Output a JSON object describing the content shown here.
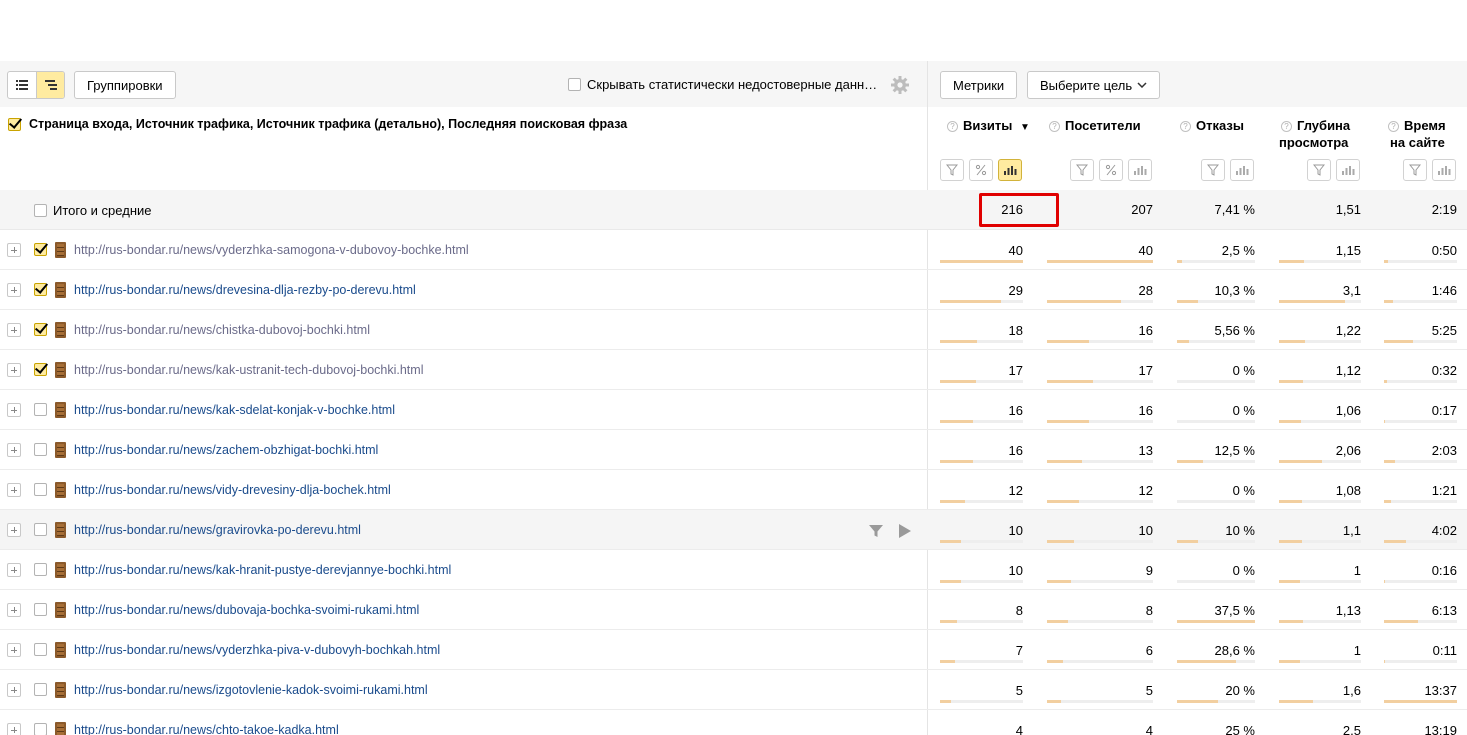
{
  "toolbar": {
    "groupings_label": "Группировки",
    "hide_stat_label": "Скрывать статистически недостоверные данн…",
    "metrics_label": "Метрики",
    "goal_label": "Выберите цель"
  },
  "table": {
    "dimension_header": "Страница входа, Источник трафика, Источник трафика (детально), Последняя поисковая фраза",
    "columns": [
      {
        "label": "Визиты",
        "sort": "▼"
      },
      {
        "label": "Посетители"
      },
      {
        "label": "Отказы"
      },
      {
        "label": "Глубина просмотра",
        "line1": "Глубина",
        "line2": "просмотра"
      },
      {
        "label": "Время на сайте",
        "line1": "Время",
        "line2": "на сайте"
      }
    ],
    "totals": {
      "label": "Итого и средние",
      "visits": "216",
      "visitors": "207",
      "bounces": "7,41 %",
      "depth": "1,51",
      "time": "2:19"
    },
    "rows": [
      {
        "url": "http://rus-bondar.ru/news/vyderzhka-samogona-v-dubovoy-bochke.html",
        "checked": true,
        "visited": true,
        "visits": "40",
        "visitors": "40",
        "bounces": "2,5 %",
        "depth": "1,15",
        "time": "0:50",
        "fill": [
          1.0,
          1.0,
          0.07,
          0.3,
          0.05
        ]
      },
      {
        "url": "http://rus-bondar.ru/news/drevesina-dlja-rezby-po-derevu.html",
        "checked": true,
        "visited": false,
        "visits": "29",
        "visitors": "28",
        "bounces": "10,3 %",
        "depth": "3,1",
        "time": "1:46",
        "fill": [
          0.73,
          0.7,
          0.27,
          0.8,
          0.13
        ]
      },
      {
        "url": "http://rus-bondar.ru/news/chistka-dubovoj-bochki.html",
        "checked": true,
        "visited": true,
        "visits": "18",
        "visitors": "16",
        "bounces": "5,56 %",
        "depth": "1,22",
        "time": "5:25",
        "fill": [
          0.45,
          0.4,
          0.15,
          0.32,
          0.4
        ]
      },
      {
        "url": "http://rus-bondar.ru/news/kak-ustranit-tech-dubovoj-bochki.html",
        "checked": true,
        "visited": true,
        "visits": "17",
        "visitors": "17",
        "bounces": "0 %",
        "depth": "1,12",
        "time": "0:32",
        "fill": [
          0.43,
          0.43,
          0.0,
          0.29,
          0.04
        ]
      },
      {
        "url": "http://rus-bondar.ru/news/kak-sdelat-konjak-v-bochke.html",
        "checked": false,
        "visited": false,
        "visits": "16",
        "visitors": "16",
        "bounces": "0 %",
        "depth": "1,06",
        "time": "0:17",
        "fill": [
          0.4,
          0.4,
          0.0,
          0.27,
          0.02
        ]
      },
      {
        "url": "http://rus-bondar.ru/news/zachem-obzhigat-bochki.html",
        "checked": false,
        "visited": false,
        "visits": "16",
        "visitors": "13",
        "bounces": "12,5 %",
        "depth": "2,06",
        "time": "2:03",
        "fill": [
          0.4,
          0.33,
          0.33,
          0.53,
          0.15
        ]
      },
      {
        "url": "http://rus-bondar.ru/news/vidy-drevesiny-dlja-bochek.html",
        "checked": false,
        "visited": false,
        "visits": "12",
        "visitors": "12",
        "bounces": "0 %",
        "depth": "1,08",
        "time": "1:21",
        "fill": [
          0.3,
          0.3,
          0.0,
          0.28,
          0.1
        ]
      },
      {
        "url": "http://rus-bondar.ru/news/gravirovka-po-derevu.html",
        "checked": false,
        "visited": false,
        "hover": true,
        "visits": "10",
        "visitors": "10",
        "bounces": "10 %",
        "depth": "1,1",
        "time": "4:02",
        "fill": [
          0.25,
          0.25,
          0.27,
          0.28,
          0.3
        ]
      },
      {
        "url": "http://rus-bondar.ru/news/kak-hranit-pustye-derevjannye-bochki.html",
        "checked": false,
        "visited": false,
        "visits": "10",
        "visitors": "9",
        "bounces": "0 %",
        "depth": "1",
        "time": "0:16",
        "fill": [
          0.25,
          0.23,
          0.0,
          0.26,
          0.02
        ]
      },
      {
        "url": "http://rus-bondar.ru/news/dubovaja-bochka-svoimi-rukami.html",
        "checked": false,
        "visited": false,
        "visits": "8",
        "visitors": "8",
        "bounces": "37,5 %",
        "depth": "1,13",
        "time": "6:13",
        "fill": [
          0.2,
          0.2,
          1.0,
          0.29,
          0.46
        ]
      },
      {
        "url": "http://rus-bondar.ru/news/vyderzhka-piva-v-dubovyh-bochkah.html",
        "checked": false,
        "visited": false,
        "visits": "7",
        "visitors": "6",
        "bounces": "28,6 %",
        "depth": "1",
        "time": "0:11",
        "fill": [
          0.18,
          0.15,
          0.76,
          0.26,
          0.01
        ]
      },
      {
        "url": "http://rus-bondar.ru/news/izgotovlenie-kadok-svoimi-rukami.html",
        "checked": false,
        "visited": false,
        "visits": "5",
        "visitors": "5",
        "bounces": "20 %",
        "depth": "1,6",
        "time": "13:37",
        "fill": [
          0.13,
          0.13,
          0.53,
          0.41,
          1.0
        ]
      },
      {
        "url": "http://rus-bondar.ru/news/chto-takoe-kadka.html",
        "checked": false,
        "visited": false,
        "visits": "4",
        "visitors": "4",
        "bounces": "25 %",
        "depth": "2,5",
        "time": "13:19",
        "fill": [
          0.1,
          0.1,
          0.67,
          0.64,
          0.98
        ]
      }
    ]
  },
  "icons": {
    "list_view": "list-view-icon",
    "tree_view": "tree-view-icon",
    "settings": "gear-icon",
    "filter": "filter-icon",
    "percent": "percent-icon",
    "chart": "bar-chart-icon",
    "favicon": "barrel-favicon-icon",
    "play": "play-icon"
  },
  "colors": {
    "accent": "#ffeba0",
    "link": "#1a4b8c",
    "highlight": "#e00000",
    "bar": "#f2cfa0"
  }
}
